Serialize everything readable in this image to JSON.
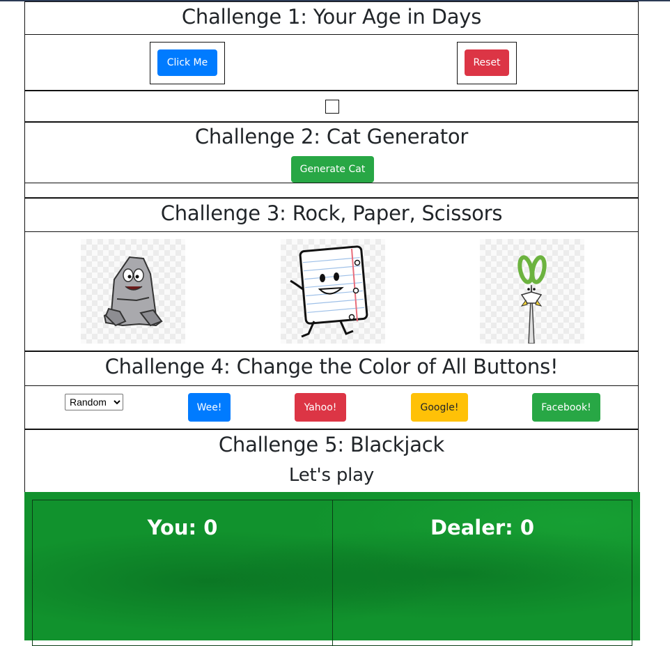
{
  "challenge1": {
    "title": "Challenge 1: Your Age in Days",
    "click_label": "Click Me",
    "reset_label": "Reset"
  },
  "challenge2": {
    "title": "Challenge 2: Cat Generator",
    "generate_label": "Generate Cat"
  },
  "challenge3": {
    "title": "Challenge 3: Rock, Paper, Scissors",
    "choices": [
      "rock",
      "paper",
      "scissors"
    ]
  },
  "challenge4": {
    "title": "Challenge 4: Change the Color of All Buttons!",
    "select_value": "Random",
    "buttons": [
      {
        "label": "Wee!",
        "color": "#007bff"
      },
      {
        "label": "Yahoo!",
        "color": "#dc3545"
      },
      {
        "label": "Google!",
        "color": "#ffc107"
      },
      {
        "label": "Facebook!",
        "color": "#28a745"
      }
    ]
  },
  "challenge5": {
    "title": "Challenge 5: Blackjack",
    "subtitle": "Let's play",
    "you_label": "You: 0",
    "dealer_label": "Dealer: 0",
    "felt_color": "#11922d"
  }
}
